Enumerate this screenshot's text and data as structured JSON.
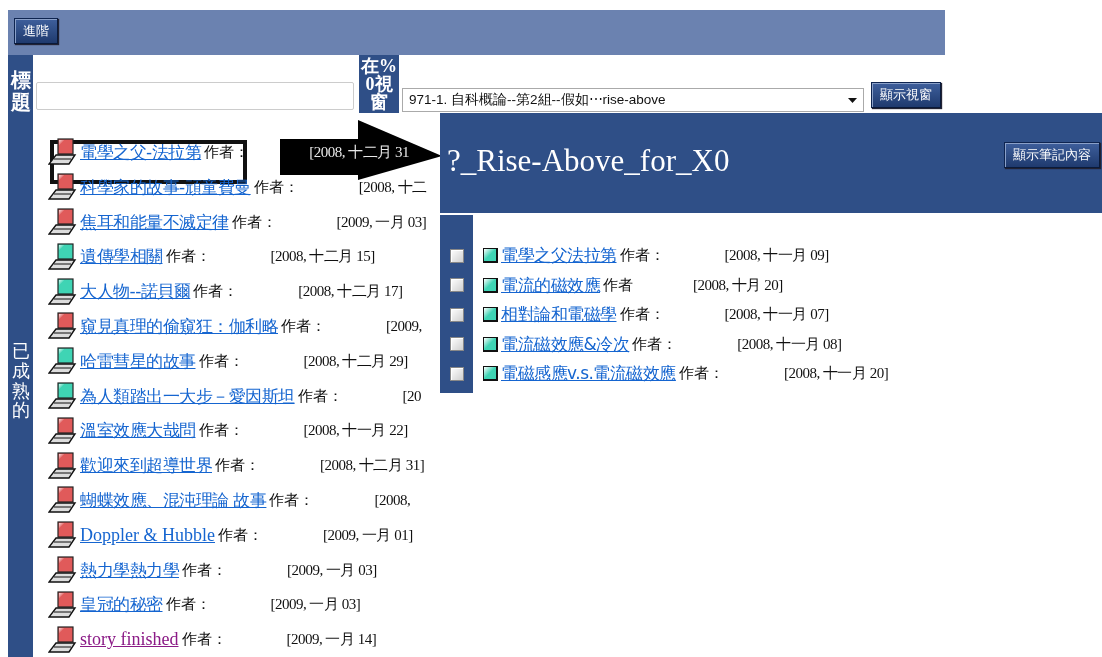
{
  "toolbar": {
    "buttons": [
      "進階"
    ]
  },
  "form": {
    "title_label": "標題",
    "view_label": "在%0視窗",
    "select": {
      "value": "971-1. 自科概論--第2組--假如⋯rise-above"
    },
    "show_button": "顯示視窗"
  },
  "section_label": "已成熟的",
  "notes": [
    {
      "title": "電學之父-法拉第",
      "author_label": "作者：",
      "date": "[2008, 十二月 31",
      "color": "#e05a5a",
      "visited": false,
      "on_arrow": true
    },
    {
      "title": "科學家的故事-頑童費曼",
      "author_label": "作者：",
      "date": "[2008, 十二",
      "color": "#e05a5a",
      "visited": false,
      "on_arrow": false
    },
    {
      "title": "焦耳和能量不滅定律",
      "author_label": "作者：",
      "date": "[2009, 一月 03]",
      "color": "#e05a5a",
      "visited": false,
      "on_arrow": false
    },
    {
      "title": "遺傳學相關",
      "author_label": "作者：",
      "date": "[2008, 十二月 15]",
      "color": "#3fd4b4",
      "visited": false,
      "on_arrow": false
    },
    {
      "title": "大人物--諾貝爾",
      "author_label": "作者：",
      "date": "[2008, 十二月 17]",
      "color": "#3fd4b4",
      "visited": false,
      "on_arrow": false
    },
    {
      "title": "窺見真理的偷窺狂：伽利略",
      "author_label": "作者：",
      "date": "[2009,",
      "color": "#e05a5a",
      "visited": false,
      "on_arrow": false
    },
    {
      "title": "哈雷彗星的故事",
      "author_label": "作者：",
      "date": "[2008, 十二月 29]",
      "color": "#3fd4b4",
      "visited": false,
      "on_arrow": false
    },
    {
      "title": "為人類踏出一大步－愛因斯坦",
      "author_label": "作者：",
      "date": "[20",
      "color": "#3fd4b4",
      "visited": false,
      "on_arrow": false
    },
    {
      "title": "溫室效應大哉問",
      "author_label": "作者：",
      "date": "[2008, 十一月 22]",
      "color": "#e05a5a",
      "visited": false,
      "on_arrow": false
    },
    {
      "title": "歡迎來到超導世界",
      "author_label": "作者：",
      "date": "[2008, 十二月 31]",
      "color": "#e05a5a",
      "visited": false,
      "on_arrow": false
    },
    {
      "title": "蝴蝶效應、混沌理論 故事",
      "author_label": "作者：",
      "date": "[2008,",
      "color": "#e05a5a",
      "visited": false,
      "on_arrow": false
    },
    {
      "title": "Doppler & Hubble",
      "author_label": "作者：",
      "date": "[2009, 一月 01]",
      "color": "#e05a5a",
      "visited": false,
      "on_arrow": false
    },
    {
      "title": "熱力學熱力學",
      "author_label": "作者：",
      "date": "[2009, 一月 03]",
      "color": "#e05a5a",
      "visited": false,
      "on_arrow": false
    },
    {
      "title": "皇冠的秘密",
      "author_label": "作者：",
      "date": "[2009, 一月 03]",
      "color": "#e05a5a",
      "visited": false,
      "on_arrow": false
    },
    {
      "title": "story finished",
      "author_label": "作者：",
      "date": "[2009, 一月 14]",
      "color": "#e05a5a",
      "visited": true,
      "on_arrow": false
    }
  ],
  "popup": {
    "title": "?_Rise-Above_for_X0",
    "button": "顯示筆記內容",
    "notes": [
      {
        "title": "電學之父法拉第",
        "author_label": "作者：",
        "date": "[2008, 十一月 09]",
        "checked": false
      },
      {
        "title": "電流的磁效應",
        "author_label": "作者",
        "date": "[2008, 十月 20]",
        "checked": false
      },
      {
        "title": "相對論和電磁學",
        "author_label": "作者：",
        "date": "[2008, 十一月 07]",
        "checked": false
      },
      {
        "title": "電流磁效應&冷次",
        "author_label": "作者：",
        "date": "[2008, 十一月 08]",
        "checked": false
      },
      {
        "title": "電磁感應v.s.電流磁效應",
        "author_label": "作者：",
        "date": "[2008, 十一月 20]",
        "checked": false
      }
    ]
  }
}
